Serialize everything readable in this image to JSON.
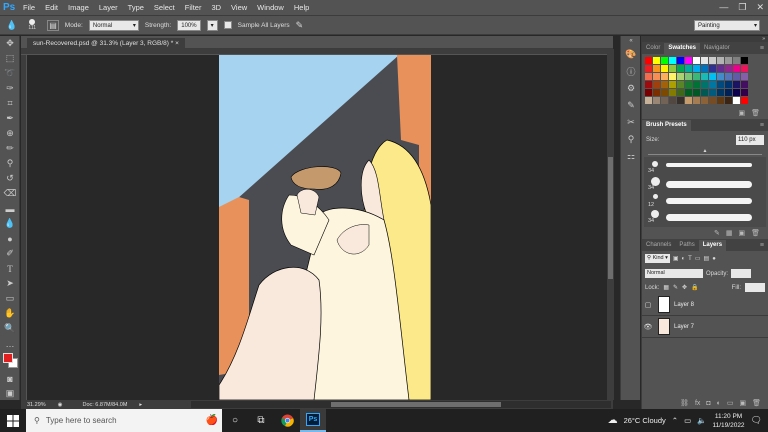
{
  "app": {
    "logo": "Ps"
  },
  "menu": [
    "File",
    "Edit",
    "Image",
    "Layer",
    "Type",
    "Select",
    "Filter",
    "3D",
    "View",
    "Window",
    "Help"
  ],
  "window_controls": [
    "—",
    "❐",
    "✕"
  ],
  "options": {
    "brush_size": "111",
    "mode_label": "Mode:",
    "mode_value": "Normal",
    "strength_label": "Strength:",
    "strength_value": "100%",
    "sample_all_label": "Sample All Layers",
    "workspace": "Painting"
  },
  "document": {
    "tab_label": "sun-Recovered.psd @ 31.3% (Layer 3, RGB/8) *",
    "zoom": "31.29%",
    "doc_info": "Doc: 6.87M/84.0M"
  },
  "panels": {
    "color_tabs": [
      "Color",
      "Swatches",
      "Navigator"
    ],
    "brush_presets_title": "Brush Presets",
    "brush_size_label": "Size:",
    "brush_size_value": "110 px",
    "brush_sizes": [
      "34",
      "34",
      "12",
      "34"
    ],
    "layers_tabs": [
      "Channels",
      "Paths",
      "Layers"
    ],
    "kind_label": "Kind",
    "blend_mode": "Normal",
    "opacity_label": "Opacity:",
    "lock_label": "Lock:",
    "fill_label": "Fill:",
    "layers": [
      {
        "name": "Layer 8"
      },
      {
        "name": "Layer 7"
      }
    ]
  },
  "colors": {
    "foreground": "#e02020",
    "background": "#ffffff",
    "sky": "#a6d4f0",
    "wall_gray": "#4b4c52",
    "wall_orange": "#e8915a",
    "skin": "#f9e8dc",
    "dress": "#fdf5de",
    "hair": "#fbe98a",
    "bread": "#c49a6c"
  },
  "taskbar": {
    "search_placeholder": "Type here to search",
    "weather": "26°C  Cloudy",
    "time": "11:20 PM",
    "date": "11/19/2022"
  }
}
